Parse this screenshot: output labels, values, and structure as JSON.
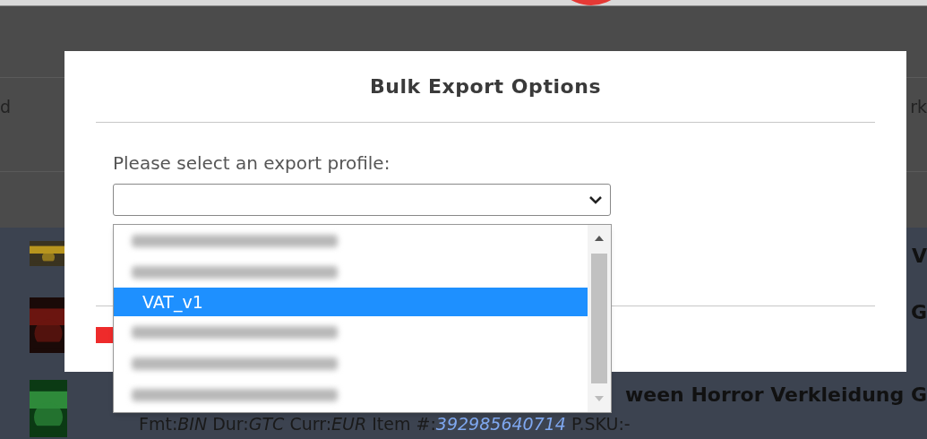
{
  "page": {
    "header_left": "d",
    "header_right": "rk",
    "rows": [
      {
        "title": "V"
      },
      {
        "title": "G"
      },
      {
        "title": "ween Horror Verkleidung G",
        "meta": "Fmt:*BIN* Dur:*GTC* Curr:*EUR* Item #:",
        "item_number": "392985640714",
        "sku": "P.SKU:-"
      }
    ]
  },
  "dialog": {
    "title": "Bulk Export Options",
    "prompt": "Please select an export profile:",
    "options": [
      {
        "kind": "blurred",
        "selected": false
      },
      {
        "kind": "blurred",
        "selected": false
      },
      {
        "kind": "text",
        "label": "VAT_v1",
        "selected": true
      },
      {
        "kind": "blurred",
        "selected": false
      },
      {
        "kind": "blurred",
        "selected": false
      },
      {
        "kind": "blurred",
        "selected": false
      }
    ]
  }
}
